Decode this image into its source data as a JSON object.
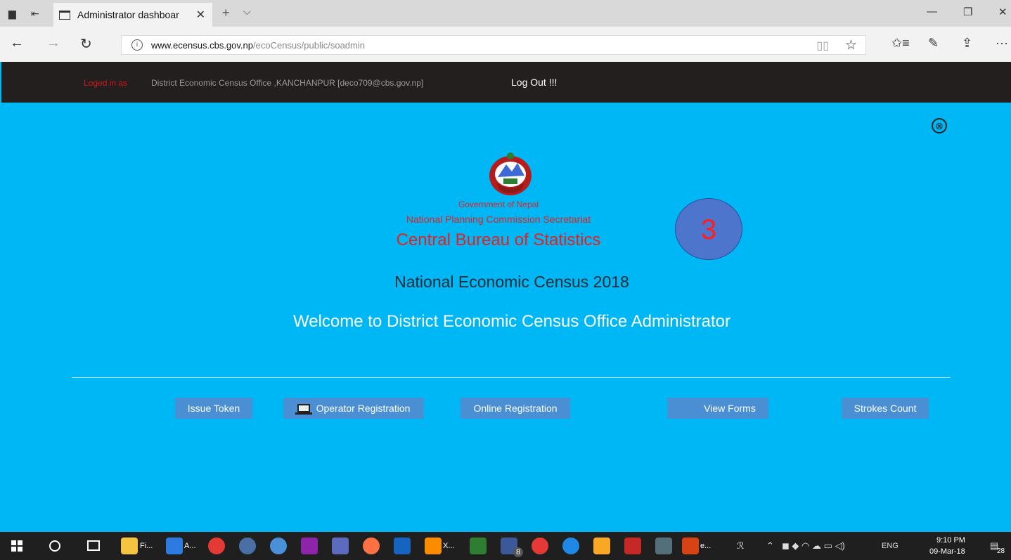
{
  "browser": {
    "tab_title": "Administrator dashboar",
    "tab_close": "✕",
    "new_tab": "+",
    "tab_dropdown": "⌵",
    "url_host": "www.ecensus.cbs.gov.np",
    "url_path": "/ecoCensus/public/soadmin",
    "back": "←",
    "forward": "→",
    "refresh": "↻",
    "minimize": "—",
    "maximize": "❐",
    "close": "✕",
    "star": "☆",
    "favorites": "✩≡",
    "pen": "✎",
    "share": "⇪",
    "more": "···"
  },
  "header": {
    "logged_label": "Loged in as",
    "user_info": "District Economic Census Office ,KANCHANPUR [deco709@cbs.gov.np]",
    "logout": "Log Out !!!"
  },
  "close_icon": "⊗",
  "org": {
    "line1": "Government of Nepal",
    "line2": "National Planning Commission Secretariat",
    "line3": "Central Bureau of Statistics"
  },
  "census_title": "National Economic Census 2018",
  "welcome": "Welcome to District Economic Census Office Administrator",
  "annotation": "3",
  "buttons": {
    "issue_token": "Issue Token",
    "operator_registration": "Operator Registration",
    "online_registration": "Online Registration",
    "view_forms": "View Forms",
    "strokes_count": "Strokes Count"
  },
  "taskbar": {
    "file_label": "Fi...",
    "edge_label": "A...",
    "xampp_label": "X...",
    "fb_badge": "8",
    "ppt_label": "e...",
    "lang": "ENG",
    "time": "9:10 PM",
    "date": "09-Mar-18",
    "notif_count": "28"
  },
  "colors": {
    "page_bg": "#00b7f5",
    "header_bg": "#231f1f",
    "button_bg": "#4a8fd4",
    "accent_red": "#e62020"
  }
}
